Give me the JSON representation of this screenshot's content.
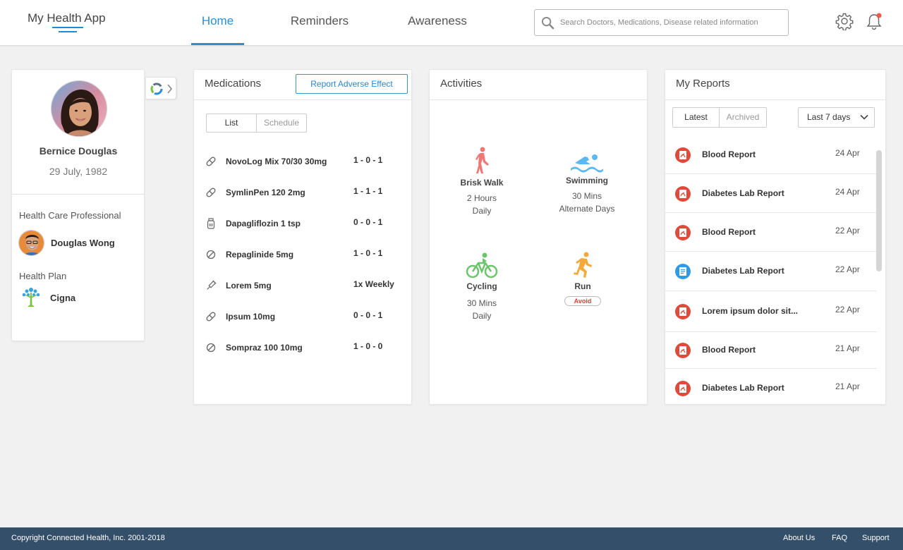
{
  "header": {
    "app_title": "My Health App",
    "tabs": [
      {
        "label": "Home",
        "active": true
      },
      {
        "label": "Reminders",
        "active": false
      },
      {
        "label": "Awareness",
        "active": false
      }
    ],
    "search_placeholder": "Search Doctors, Medications, Disease related information",
    "settings_icon": "gear-icon",
    "notifications_icon": "bell-icon",
    "notification_dot_color": "#f05a47",
    "accent_color": "#2a8ed8"
  },
  "profile": {
    "name": "Bernice Douglas",
    "dob": "29 July, 1982",
    "hcp_label": "Health Care Professional",
    "hcp_name": "Douglas Wong",
    "plan_label": "Health Plan",
    "plan_name": "Cigna"
  },
  "medications": {
    "title": "Medications",
    "report_button": "Report Adverse Effect",
    "views": [
      {
        "label": "List",
        "active": true
      },
      {
        "label": "Schedule",
        "active": false
      }
    ],
    "items": [
      {
        "name": "NovoLog Mix 70/30 30mg",
        "dose": "1 - 0 - 1",
        "icon": "capsule-icon"
      },
      {
        "name": "SymlinPen 120 2mg",
        "dose": "1 - 1 - 1",
        "icon": "capsule-icon"
      },
      {
        "name": "Dapagliflozin 1 tsp",
        "dose": "0 - 0 - 1",
        "icon": "syrup-bottle-icon"
      },
      {
        "name": "Repaglinide 5mg",
        "dose": "1 - 0 - 1",
        "icon": "tablet-icon"
      },
      {
        "name": "Lorem 5mg",
        "dose": "1x Weekly",
        "icon": "syringe-icon"
      },
      {
        "name": "Ipsum 10mg",
        "dose": "0 - 0 - 1",
        "icon": "capsule-icon"
      },
      {
        "name": "Sompraz 100 10mg",
        "dose": "1 - 0 - 0",
        "icon": "tablet-icon"
      }
    ]
  },
  "activities": {
    "title": "Activities",
    "items": [
      {
        "name": "Brisk Walk",
        "detail1": "2 Hours",
        "detail2": "Daily",
        "icon": "walking-icon",
        "color": "#f07874"
      },
      {
        "name": "Swimming",
        "detail1": "30 Mins",
        "detail2": "Alternate Days",
        "icon": "swimming-icon",
        "color": "#5bb8f0"
      },
      {
        "name": "Cycling",
        "detail1": "30 Mins",
        "detail2": "Daily",
        "icon": "cycling-icon",
        "color": "#6cc46c"
      },
      {
        "name": "Run",
        "badge": "Avoid",
        "icon": "running-icon",
        "color": "#f6a93b"
      }
    ]
  },
  "reports": {
    "title": "My Reports",
    "tabs": [
      {
        "label": "Latest",
        "active": true
      },
      {
        "label": "Archived",
        "active": false
      }
    ],
    "filter": "Last 7 days",
    "items": [
      {
        "name": "Blood Report",
        "date": "24 Apr",
        "type": "pdf"
      },
      {
        "name": "Diabetes Lab Report",
        "date": "24 Apr",
        "type": "pdf"
      },
      {
        "name": "Blood Report",
        "date": "22 Apr",
        "type": "pdf"
      },
      {
        "name": "Diabetes Lab Report",
        "date": "22 Apr",
        "type": "doc"
      },
      {
        "name": "Lorem ipsum dolor sit...",
        "date": "22 Apr",
        "type": "pdf"
      },
      {
        "name": "Blood Report",
        "date": "21 Apr",
        "type": "pdf"
      },
      {
        "name": "Diabetes Lab Report",
        "date": "21 Apr",
        "type": "pdf"
      }
    ],
    "pdf_color": "#e04a3a",
    "doc_color": "#2d9be8"
  },
  "footer": {
    "copyright": "Copyright Connected Health, Inc. 2001-2018",
    "links": [
      "About Us",
      "FAQ",
      "Support"
    ]
  }
}
